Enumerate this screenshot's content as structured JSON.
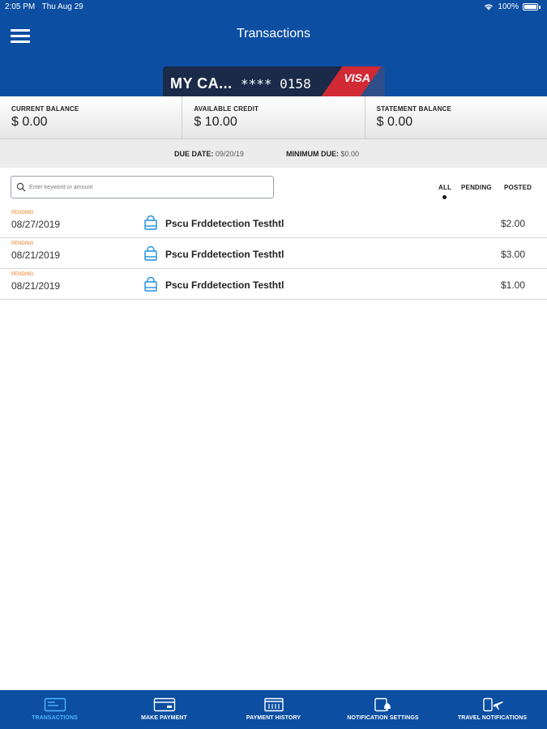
{
  "status_bar": {
    "time": "2:05 PM",
    "date": "Thu Aug 29",
    "battery": "100%"
  },
  "header": {
    "title": "Transactions"
  },
  "card": {
    "name": "MY CA...",
    "number": "**** 0158",
    "brand": "VISA"
  },
  "balances": [
    {
      "label": "CURRENT BALANCE",
      "value": "$ 0.00"
    },
    {
      "label": "AVAILABLE CREDIT",
      "value": "$ 10.00"
    },
    {
      "label": "STATEMENT BALANCE",
      "value": "$ 0.00"
    }
  ],
  "due": {
    "due_date_label": "DUE DATE:",
    "due_date_value": "09/20/19",
    "min_due_label": "MINIMUM DUE:",
    "min_due_value": "$0.00"
  },
  "search": {
    "placeholder": "Enter keyword or amount"
  },
  "filters": {
    "all": "ALL",
    "pending": "PENDING",
    "posted": "POSTED",
    "selected": "ALL"
  },
  "transactions": [
    {
      "status": "PENDING",
      "date": "08/27/2019",
      "description": "Pscu Frddetection Testhtl",
      "amount": "$2.00"
    },
    {
      "status": "PENDING",
      "date": "08/21/2019",
      "description": "Pscu Frddetection Testhtl",
      "amount": "$3.00"
    },
    {
      "status": "PENDING",
      "date": "08/21/2019",
      "description": "Pscu Frddetection Testhtl",
      "amount": "$1.00"
    }
  ],
  "bottom_nav": [
    {
      "label": "TRANSACTIONS",
      "icon": "card-icon",
      "active": true
    },
    {
      "label": "MAKE PAYMENT",
      "icon": "payment-icon",
      "active": false
    },
    {
      "label": "PAYMENT HISTORY",
      "icon": "calendar-icon",
      "active": false
    },
    {
      "label": "NOTIFICATION SETTINGS",
      "icon": "notification-icon",
      "active": false
    },
    {
      "label": "TRAVEL NOTIFICATIONS",
      "icon": "airplane-icon",
      "active": false
    }
  ],
  "colors": {
    "brand_blue": "#0b4ea2",
    "pending_orange": "#e87b1e",
    "active_nav": "#4fb4ff"
  }
}
